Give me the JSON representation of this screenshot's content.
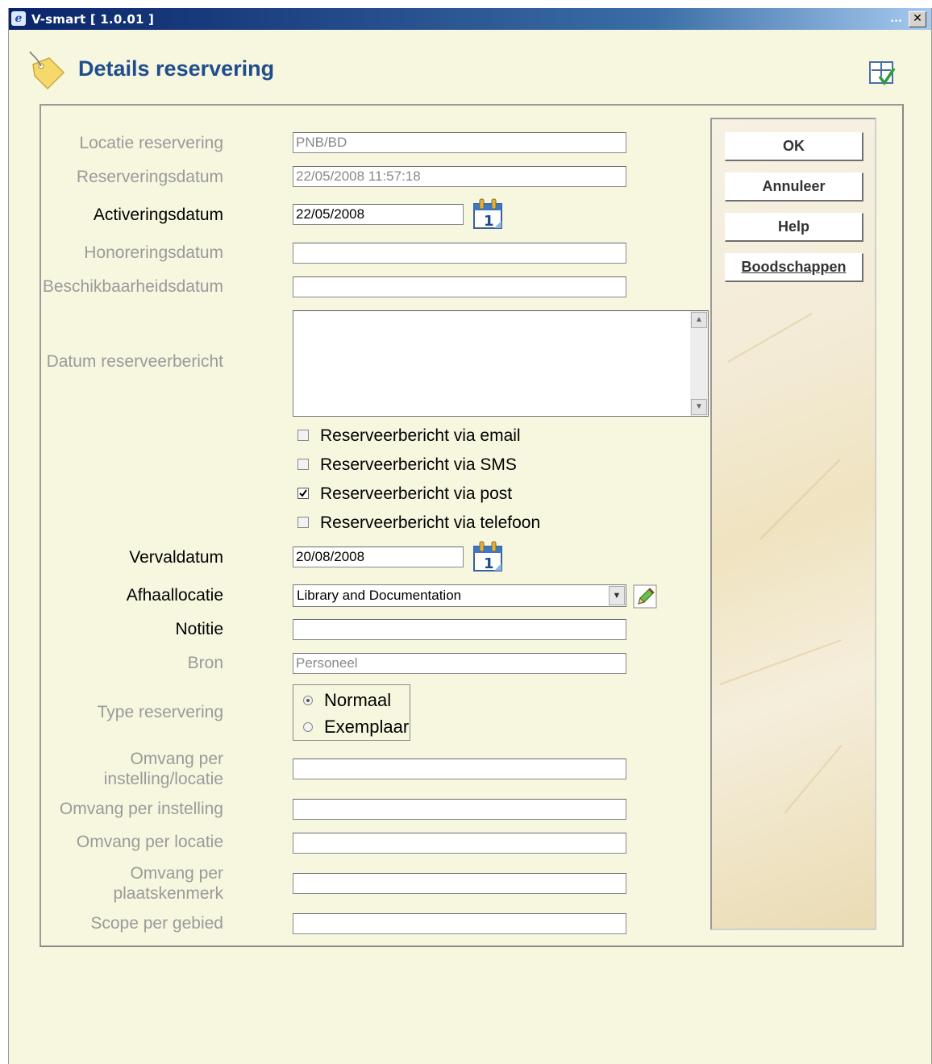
{
  "window": {
    "title": "V-smart [ 1.0.01 ]",
    "title_dots": "...",
    "close_label": "✕"
  },
  "page": {
    "title": "Details reservering"
  },
  "form": {
    "locatie": {
      "label": "Locatie reservering",
      "value": "PNB/BD"
    },
    "reserveringsdatum": {
      "label": "Reserveringsdatum",
      "value": "22/05/2008 11:57:18"
    },
    "activeringsdatum": {
      "label": "Activeringsdatum",
      "value": "22/05/2008"
    },
    "honoreringsdatum": {
      "label": "Honoreringsdatum",
      "value": ""
    },
    "beschikbaarheidsdatum": {
      "label": "Beschikbaarheidsdatum",
      "value": ""
    },
    "datum_reserveerbericht": {
      "label": "Datum reserveerbericht",
      "value": ""
    },
    "checkboxes": [
      {
        "label": "Reserveerbericht via email",
        "checked": false
      },
      {
        "label": "Reserveerbericht via SMS",
        "checked": false
      },
      {
        "label": "Reserveerbericht via post",
        "checked": true
      },
      {
        "label": "Reserveerbericht via telefoon",
        "checked": false
      }
    ],
    "vervaldatum": {
      "label": "Vervaldatum",
      "value": "20/08/2008"
    },
    "afhaallocatie": {
      "label": "Afhaallocatie",
      "value": "Library and Documentation"
    },
    "notitie": {
      "label": "Notitie",
      "value": ""
    },
    "bron": {
      "label": "Bron",
      "value": "Personeel"
    },
    "type_reservering": {
      "label": "Type reservering",
      "options": [
        {
          "label": "Normaal",
          "selected": true
        },
        {
          "label": "Exemplaar",
          "selected": false
        }
      ]
    },
    "omvang_instelling_locatie": {
      "label_line1": "Omvang per",
      "label_line2": "instelling/locatie",
      "value": ""
    },
    "omvang_instelling": {
      "label": "Omvang per instelling",
      "value": ""
    },
    "omvang_locatie": {
      "label": "Omvang per locatie",
      "value": ""
    },
    "omvang_plaatskenmerk": {
      "label_line1": "Omvang per",
      "label_line2": "plaatskenmerk",
      "value": ""
    },
    "scope_gebied": {
      "label": "Scope per gebied",
      "value": ""
    }
  },
  "buttons": {
    "ok": "OK",
    "annuleer": "Annuleer",
    "help": "Help",
    "boodschappen": "Boodschappen"
  },
  "calendar_icon_text": "1",
  "colors": {
    "title": "#1f4d8e",
    "background": "#f7f7df",
    "disabled_label": "#9a9a9a"
  }
}
